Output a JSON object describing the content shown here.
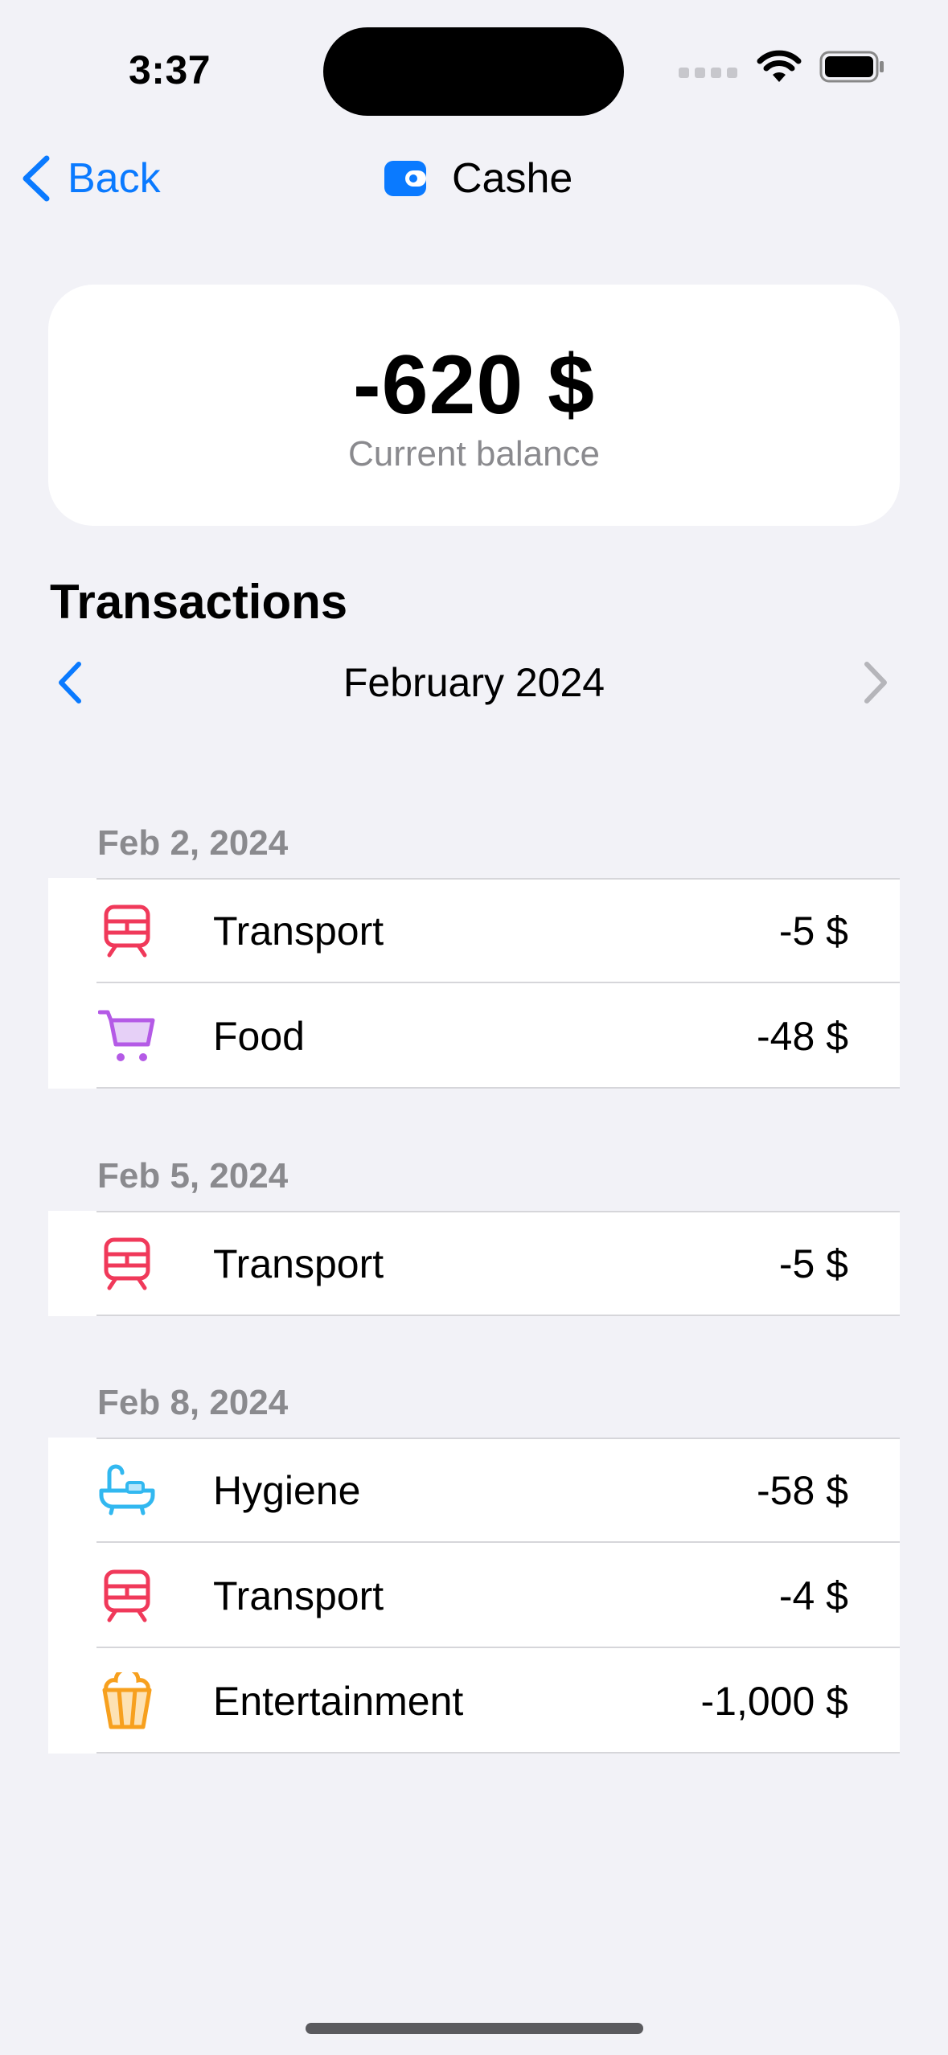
{
  "status_bar": {
    "time": "3:37"
  },
  "nav": {
    "back_label": "Back",
    "title": "Cashe"
  },
  "balance": {
    "amount": "-620 $",
    "label": "Current balance"
  },
  "transactions": {
    "title": "Transactions",
    "month": "February 2024",
    "groups": [
      {
        "date": "Feb 2, 2024",
        "items": [
          {
            "category": "Transport",
            "amount": "-5 $",
            "icon": "train-icon"
          },
          {
            "category": "Food",
            "amount": "-48 $",
            "icon": "cart-icon"
          }
        ]
      },
      {
        "date": "Feb 5, 2024",
        "items": [
          {
            "category": "Transport",
            "amount": "-5 $",
            "icon": "train-icon"
          }
        ]
      },
      {
        "date": "Feb 8, 2024",
        "items": [
          {
            "category": "Hygiene",
            "amount": "-58 $",
            "icon": "bathtub-icon"
          },
          {
            "category": "Transport",
            "amount": "-4 $",
            "icon": "train-icon"
          },
          {
            "category": "Entertainment",
            "amount": "-1,000 $",
            "icon": "popcorn-icon"
          }
        ]
      }
    ]
  },
  "colors": {
    "accent": "#0a7aff",
    "transport": "#f0395a",
    "food": "#b45ae6",
    "hygiene": "#32b8f0",
    "entertainment": "#f7a01e"
  }
}
